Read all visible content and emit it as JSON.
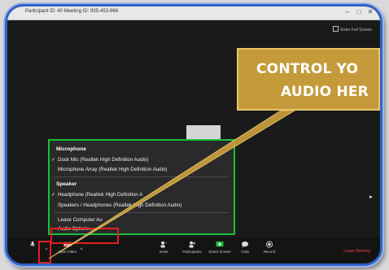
{
  "window": {
    "title": "Participant ID: 40   Meeting ID: 935-453-968"
  },
  "fullscreen_label": "Enter Full Screen",
  "callout": {
    "line1": "CONTROL YO",
    "line2": "AUDIO HER"
  },
  "audio_menu": {
    "microphone_header": "Microphone",
    "microphone_items": [
      {
        "label": "Dock Mic (Realtek High Definition Audio)",
        "selected": true
      },
      {
        "label": "Microphone Array (Realtek High Definition Audio)",
        "selected": false
      }
    ],
    "speaker_header": "Speaker",
    "speaker_items": [
      {
        "label": "Headphone (Realtek High Definition A",
        "selected": true
      },
      {
        "label": "Speakers / Headphones (Realtek High Definition Audio)",
        "selected": false
      }
    ],
    "leave_audio": "Leave Computer Au",
    "audio_options": "Audio Options..."
  },
  "toolbar": {
    "start_video": "Start Video",
    "invite": "Invite",
    "participants": "Participants",
    "share_screen": "Share Screen",
    "chat": "Chat",
    "record": "Record",
    "leave": "Leave Meeting",
    "participants_count": "1"
  },
  "colors": {
    "menu_border": "#1bbf3a",
    "callout_bg": "#c59a3a",
    "highlight": "#e02020",
    "frame": "#2f63c8"
  }
}
